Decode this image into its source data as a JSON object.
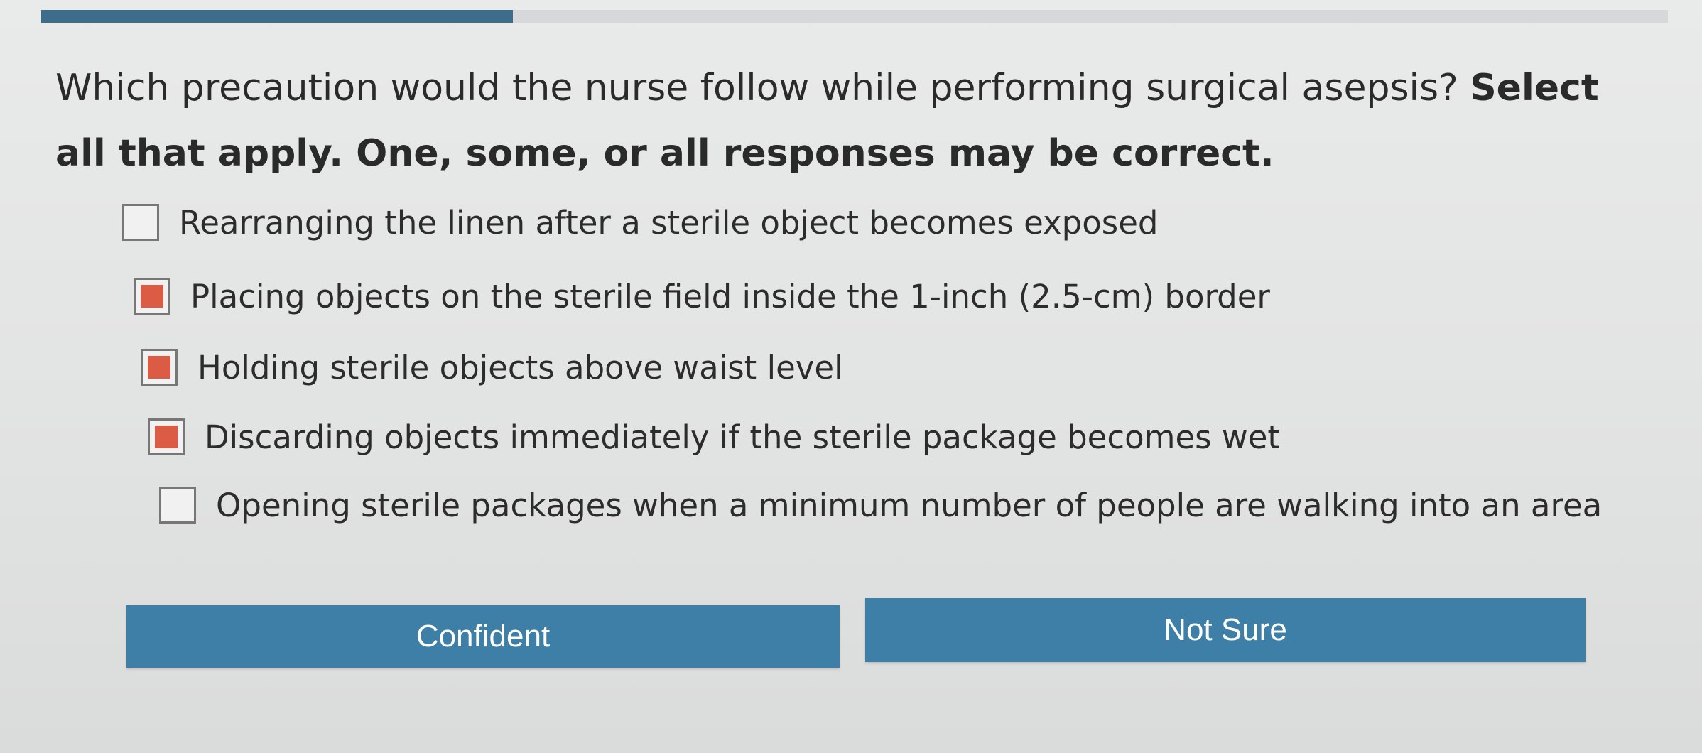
{
  "progress": {
    "fraction": 0.29,
    "color": "#3d6d8b"
  },
  "question": {
    "prompt": "Which precaution would the nurse follow while performing surgical asepsis?",
    "instruction": "Select all that apply. One, some, or all responses may be correct."
  },
  "options": [
    {
      "label": "Rearranging the linen after a sterile object becomes exposed",
      "checked": false
    },
    {
      "label": "Placing objects on the sterile field inside the 1-inch (2.5-cm) border",
      "checked": true
    },
    {
      "label": "Holding sterile objects above waist level",
      "checked": true
    },
    {
      "label": "Discarding objects immediately if the sterile package becomes wet",
      "checked": true
    },
    {
      "label": "Opening sterile packages when a minimum number of people are walking into an area",
      "checked": false
    }
  ],
  "buttons": {
    "confident": "Confident",
    "not_sure": "Not Sure"
  },
  "colors": {
    "accent": "#3d7fa6",
    "checkbox_fill": "#dc5b45"
  }
}
